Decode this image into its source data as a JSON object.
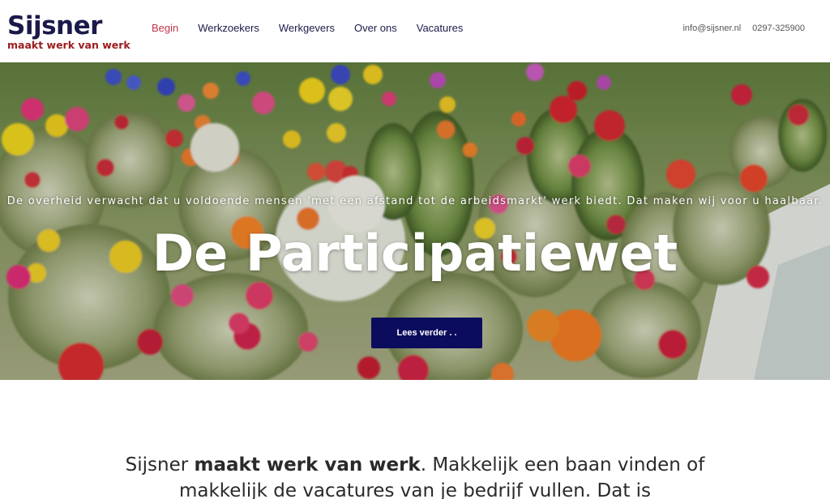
{
  "brand": {
    "name": "Sijsner",
    "tagline": "maakt werk van werk",
    "colors": {
      "navy": "#1a1a4a",
      "red": "#9b1d20",
      "active_nav": "#c0354a",
      "button": "#0c0c5e"
    }
  },
  "nav": {
    "items": [
      {
        "label": "Begin",
        "active": true
      },
      {
        "label": "Werkzoekers",
        "active": false
      },
      {
        "label": "Werkgevers",
        "active": false
      },
      {
        "label": "Over ons",
        "active": false
      },
      {
        "label": "Vacatures",
        "active": false
      }
    ]
  },
  "contact": {
    "email": "info@sijsner.nl",
    "phone": "0297-325900"
  },
  "hero": {
    "subtitle": "De overheid verwacht dat u voldoende mensen 'met een afstand tot de arbeidsmarkt' werk biedt. Dat maken wij voor u haalbaar.",
    "title": "De Participatiewet",
    "button_label": "Lees verder . ."
  },
  "intro": {
    "part1": "Sijsner ",
    "bold": "maakt werk van werk",
    "part2": ". Makkelijk een baan vinden of makkelijk de vacatures van je bedrijf vullen. Dat is"
  }
}
